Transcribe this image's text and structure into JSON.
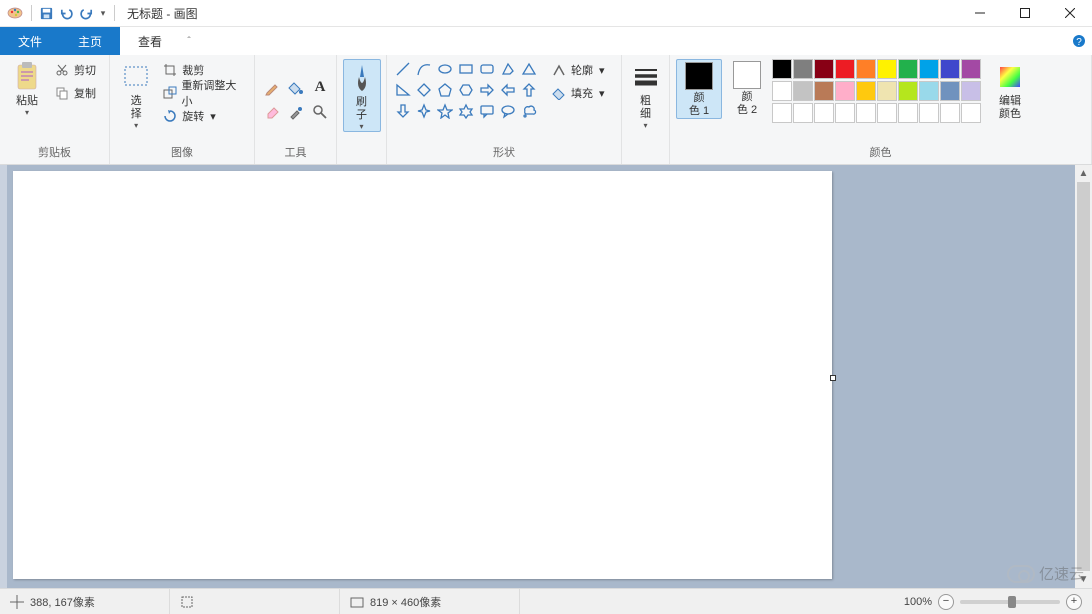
{
  "window": {
    "title": "无标题 - 画图",
    "minimize_tip": "─",
    "maximize_tip": "☐",
    "close_tip": "✕"
  },
  "tabs": {
    "file": "文件",
    "home": "主页",
    "view": "查看"
  },
  "ribbon": {
    "clipboard": {
      "paste": "粘贴",
      "cut": "剪切",
      "copy": "复制",
      "group": "剪贴板"
    },
    "image": {
      "select": "选\n择",
      "crop": "裁剪",
      "resize": "重新调整大小",
      "rotate": "旋转",
      "group": "图像"
    },
    "tools": {
      "group": "工具"
    },
    "brushes": {
      "label": "刷\n子"
    },
    "shapes": {
      "outline": "轮廓",
      "fill": "填充",
      "group": "形状"
    },
    "size": {
      "label": "粗\n细"
    },
    "colors": {
      "color1": "颜\n色 1",
      "color2": "颜\n色 2",
      "edit": "编辑\n颜色",
      "group": "颜色",
      "palette_row1": [
        "#000000",
        "#7f7f7f",
        "#880015",
        "#ed1c24",
        "#ff7f27",
        "#fff200",
        "#22b14c",
        "#00a2e8",
        "#3f48cc",
        "#a349a4"
      ],
      "palette_row2": [
        "#ffffff",
        "#c3c3c3",
        "#b97a57",
        "#ffaec9",
        "#ffc90e",
        "#efe4b0",
        "#b5e61d",
        "#99d9ea",
        "#7092be",
        "#c8bfe7"
      ]
    }
  },
  "status": {
    "cursor": "388, 167像素",
    "canvas_size": "819 × 460像素",
    "zoom": "100%"
  },
  "watermark": "亿速云"
}
